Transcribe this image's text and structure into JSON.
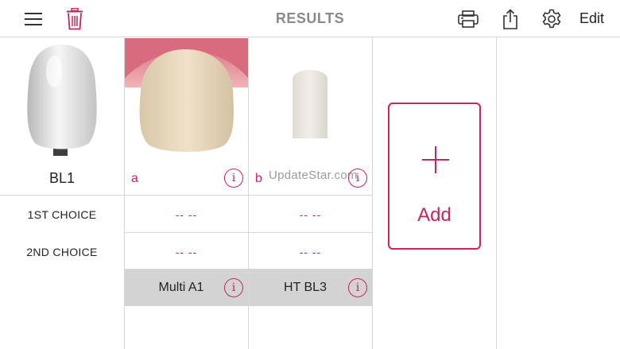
{
  "header": {
    "title": "RESULTS",
    "edit_label": "Edit"
  },
  "reference": {
    "label": "BL1"
  },
  "samples": [
    {
      "letter": "a",
      "first_choice": "-- --",
      "second_choice": "-- --",
      "result": "Multi A1"
    },
    {
      "letter": "b",
      "first_choice": "-- --",
      "second_choice": "-- --",
      "result": "HT BL3"
    }
  ],
  "rows": {
    "first_choice_label": "1ST CHOICE",
    "second_choice_label": "2ND CHOICE"
  },
  "info_glyph": "i",
  "watermark": "UpdateStar.com",
  "add": {
    "label": "Add",
    "plus": "+"
  },
  "colors": {
    "accent": "#c8245a",
    "grid": "#d6d6d6",
    "result_bg": "#d3d3d3"
  }
}
